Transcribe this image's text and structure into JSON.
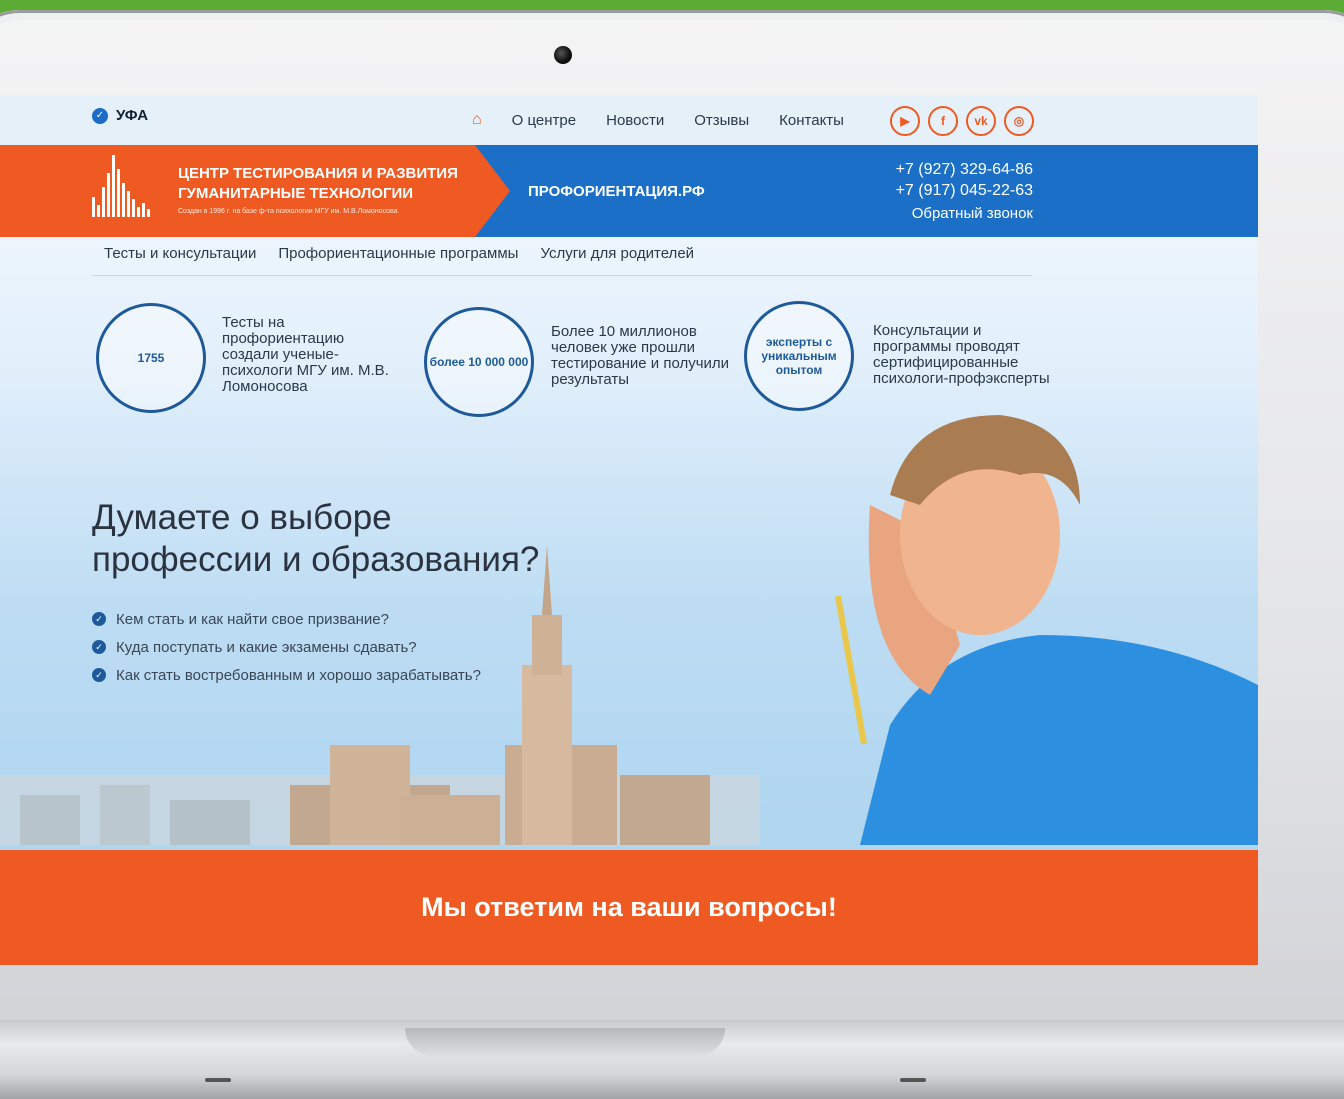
{
  "topbar": {
    "city": "УФА",
    "nav": [
      "О центре",
      "Новости",
      "Отзывы",
      "Контакты"
    ],
    "social": [
      {
        "icon": "youtube-icon",
        "glyph": "▶"
      },
      {
        "icon": "facebook-icon",
        "glyph": "f"
      },
      {
        "icon": "vk-icon",
        "glyph": "vk"
      },
      {
        "icon": "instagram-icon",
        "glyph": "◎"
      }
    ]
  },
  "banner": {
    "brand_line1": "ЦЕНТР ТЕСТИРОВАНИЯ И РАЗВИТИЯ",
    "brand_line2": "ГУМАНИТАРНЫЕ ТЕХНОЛОГИИ",
    "brand_line3": "Создан в 1996 г. на базе ф-та психологии МГУ им. М.В.Ломоносова",
    "site": "ПРОФОРИЕНТАЦИЯ.РФ",
    "phone1": "+7 (927) 329-64-86",
    "phone2": "+7 (917) 045-22-63",
    "callback": "Обратный звонок"
  },
  "subnav": [
    "Тесты и консультации",
    "Профориентационные программы",
    "Услуги для родителей"
  ],
  "features": [
    {
      "icon_text": "1755",
      "text": "Тесты на профориентацию создали ученые-психологи МГУ им. М.В. Ломоносова"
    },
    {
      "icon_text": "более 10 000 000",
      "text": "Более 10 миллионов человек уже прошли тестирование и получили результаты"
    },
    {
      "icon_text": "эксперты с уникальным опытом",
      "text": "Консультации и программы проводят сертифицированные психологи-профэксперты"
    }
  ],
  "hero": {
    "headline": "Думаете о выборе профессии и образования?",
    "bullets": [
      "Кем стать и как найти свое призвание?",
      "Куда поступать и какие экзамены сдавать?",
      "Как стать востребованным и хорошо зарабатывать?"
    ]
  },
  "cta": {
    "text": "Мы ответим на ваши вопросы!"
  },
  "colors": {
    "orange": "#ee5a22",
    "blue": "#1c6fc6",
    "green": "#5cab35"
  }
}
